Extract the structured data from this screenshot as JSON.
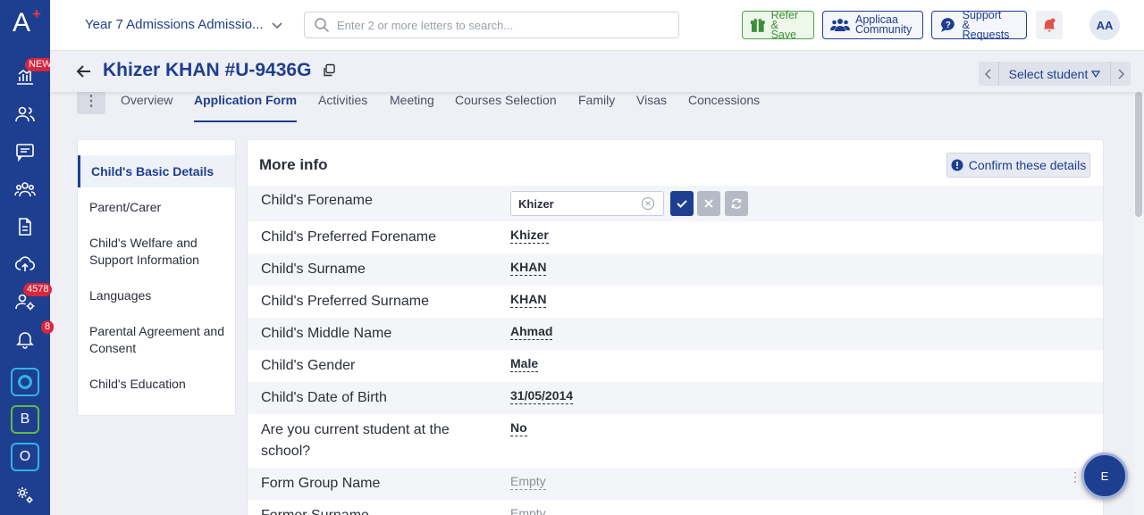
{
  "brand": {
    "accent": "#1e3e8f",
    "rail_bg": "#1e3e8f",
    "badge": "#d7263d"
  },
  "rail": {
    "logo": "A",
    "logo_plus": "+",
    "dashboard_badge": "NEW",
    "applicants_badge": "4578",
    "notifications_badge": "8",
    "app_b_label": "B",
    "app_o_label": "O"
  },
  "topbar": {
    "process_name": "Year 7 Admissions Admissio...",
    "search_placeholder": "Enter 2 or more letters to search...",
    "refer_line1": "Refer",
    "refer_line2": "& Save",
    "community_line1": "Applicaa",
    "community_line2": "Community",
    "support_line1": "Support",
    "support_line2": "& Requests",
    "avatar_initials": "AA"
  },
  "header": {
    "title": "Khizer KHAN #U-9436G",
    "select_student": "Select student"
  },
  "tabs": [
    "Overview",
    "Application Form",
    "Activities",
    "Meeting",
    "Courses Selection",
    "Family",
    "Visas",
    "Concessions"
  ],
  "sections": [
    "Child's Basic Details",
    "Parent/Carer",
    "Child's Welfare and Support Information",
    "Languages",
    "Parental Agreement and Consent",
    "Child's Education"
  ],
  "card": {
    "title": "More info",
    "confirm_label": "Confirm these details",
    "editing_value": "Khizer",
    "fields": [
      {
        "label": "Child's Forename",
        "value": ""
      },
      {
        "label": "Child's Preferred Forename",
        "value": "Khizer"
      },
      {
        "label": "Child's Surname",
        "value": "KHAN"
      },
      {
        "label": "Child's Preferred Surname",
        "value": "KHAN"
      },
      {
        "label": "Child's Middle Name",
        "value": "Ahmad"
      },
      {
        "label": "Child's Gender",
        "value": "Male"
      },
      {
        "label": "Child's Date of Birth",
        "value": "31/05/2014"
      },
      {
        "label": "Are you current student at the school?",
        "value": "No"
      },
      {
        "label": "Form Group Name",
        "value": "Empty"
      },
      {
        "label": "Former Surname",
        "value": "Empty"
      }
    ]
  },
  "fab_label": "E"
}
